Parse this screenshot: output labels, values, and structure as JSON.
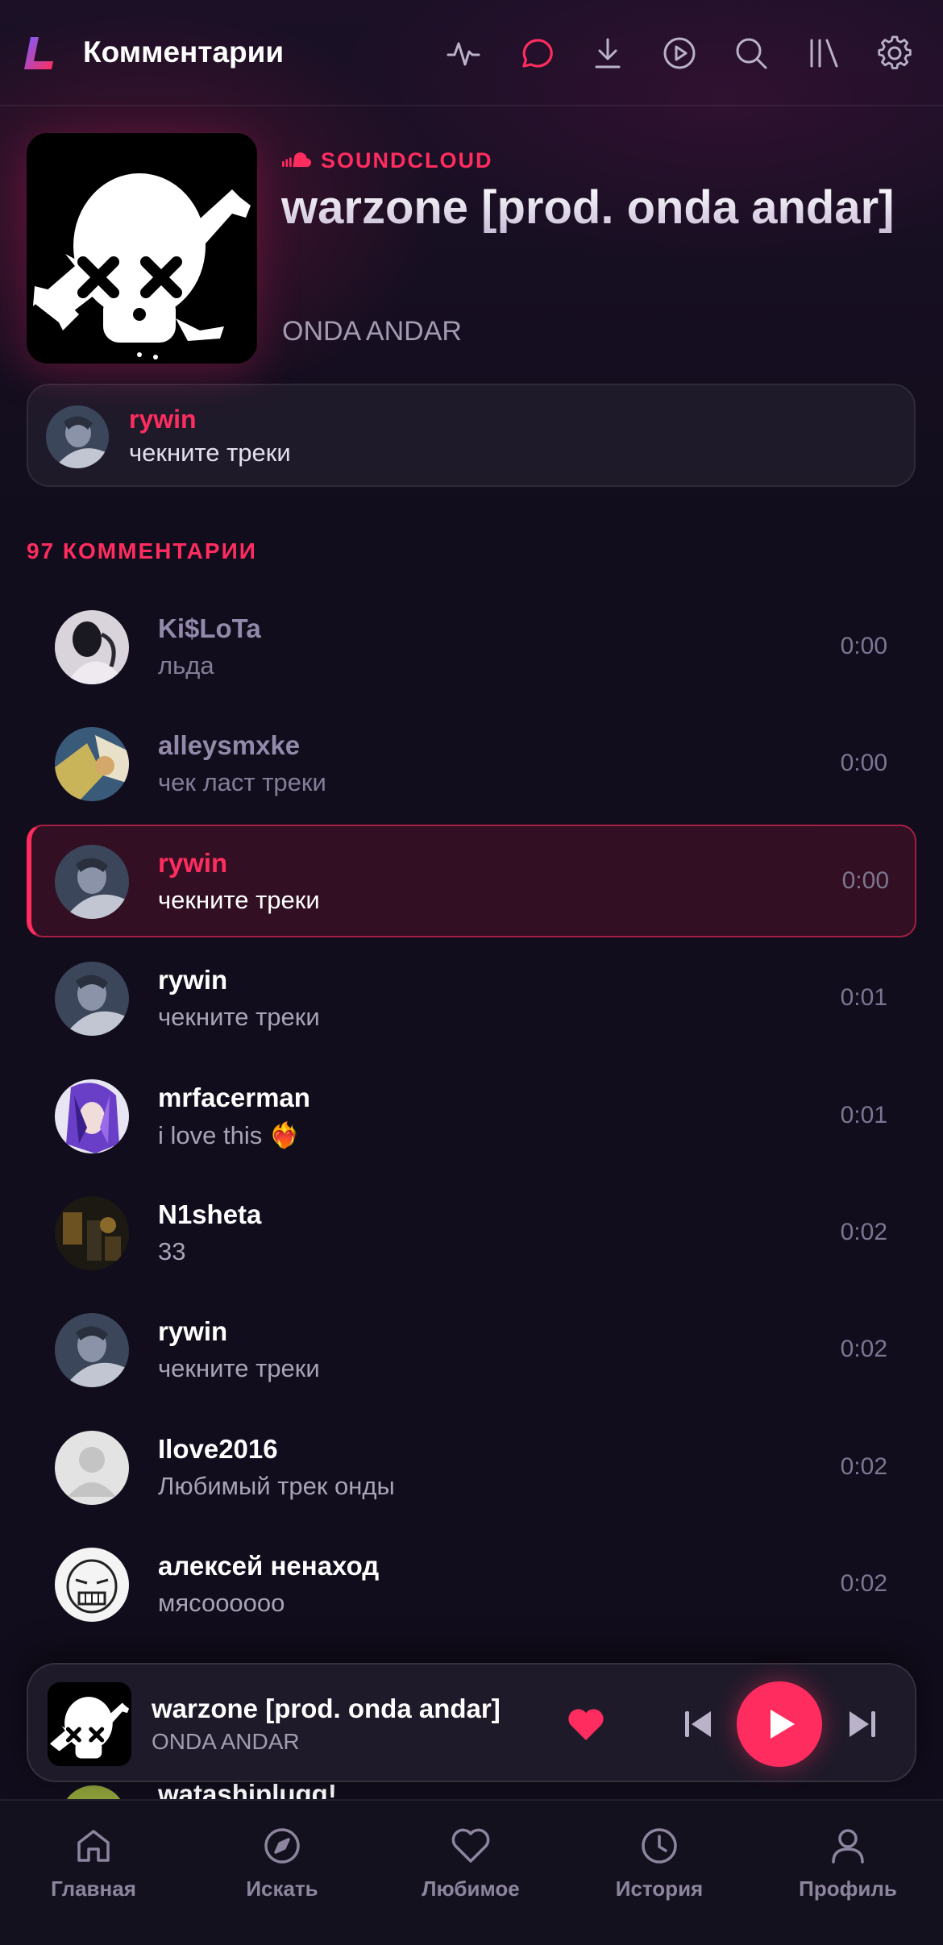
{
  "header": {
    "title": "Комментарии",
    "icons": [
      "activity-icon",
      "comments-icon",
      "download-icon",
      "play-circle-icon",
      "search-icon",
      "library-icon",
      "settings-icon"
    ],
    "active_icon": "comments-icon"
  },
  "track": {
    "source": "SOUNDCLOUD",
    "title": "warzone [prod. onda andar]",
    "artist": "ONDA ANDAR"
  },
  "pinned": {
    "user": "rywin",
    "text": "чекните треки"
  },
  "comments_header": "97 КОММЕНТАРИИ",
  "comments": [
    {
      "user": "Ki$LoTa",
      "text": "льда",
      "time": "0:00",
      "state": "dim",
      "avatar_color": "#d9d4dc"
    },
    {
      "user": "alleysmxke",
      "text": "чек ласт треки",
      "time": "0:00",
      "state": "dim",
      "avatar_color": "#b9a65a"
    },
    {
      "user": "rywin",
      "text": "чекните треки",
      "time": "0:00",
      "state": "highlight",
      "avatar_color": "#7b88a3"
    },
    {
      "user": "rywin",
      "text": "чекните треки",
      "time": "0:01",
      "state": "normal",
      "avatar_color": "#7b88a3"
    },
    {
      "user": "mrfacerman",
      "text": "i love this ❤️‍🔥",
      "time": "0:01",
      "state": "normal",
      "avatar_color": "#8a5bd8"
    },
    {
      "user": "N1sheta",
      "text": "33",
      "time": "0:02",
      "state": "normal",
      "avatar_color": "#5b4a2a"
    },
    {
      "user": "rywin",
      "text": "чекните треки",
      "time": "0:02",
      "state": "normal",
      "avatar_color": "#7b88a3"
    },
    {
      "user": "Ilove2016",
      "text": "Любимый трек онды",
      "time": "0:02",
      "state": "normal",
      "avatar_color": "#e3e3e3"
    },
    {
      "user": "алексей ненаход",
      "text": "мясоооооо",
      "time": "0:02",
      "state": "normal",
      "avatar_color": "#f2f2f2"
    }
  ],
  "peek_user": "watashiplugg!",
  "player": {
    "title": "warzone [prod. onda andar]",
    "artist": "ONDA ANDAR",
    "liked": true
  },
  "nav": [
    {
      "label": "Главная",
      "icon": "home-icon"
    },
    {
      "label": "Искать",
      "icon": "compass-icon"
    },
    {
      "label": "Любимое",
      "icon": "heart-icon"
    },
    {
      "label": "История",
      "icon": "clock-icon"
    },
    {
      "label": "Профиль",
      "icon": "profile-icon"
    }
  ],
  "colors": {
    "accent": "#ff2d5f",
    "background": "#110d1c",
    "muted": "#a39bb2"
  }
}
